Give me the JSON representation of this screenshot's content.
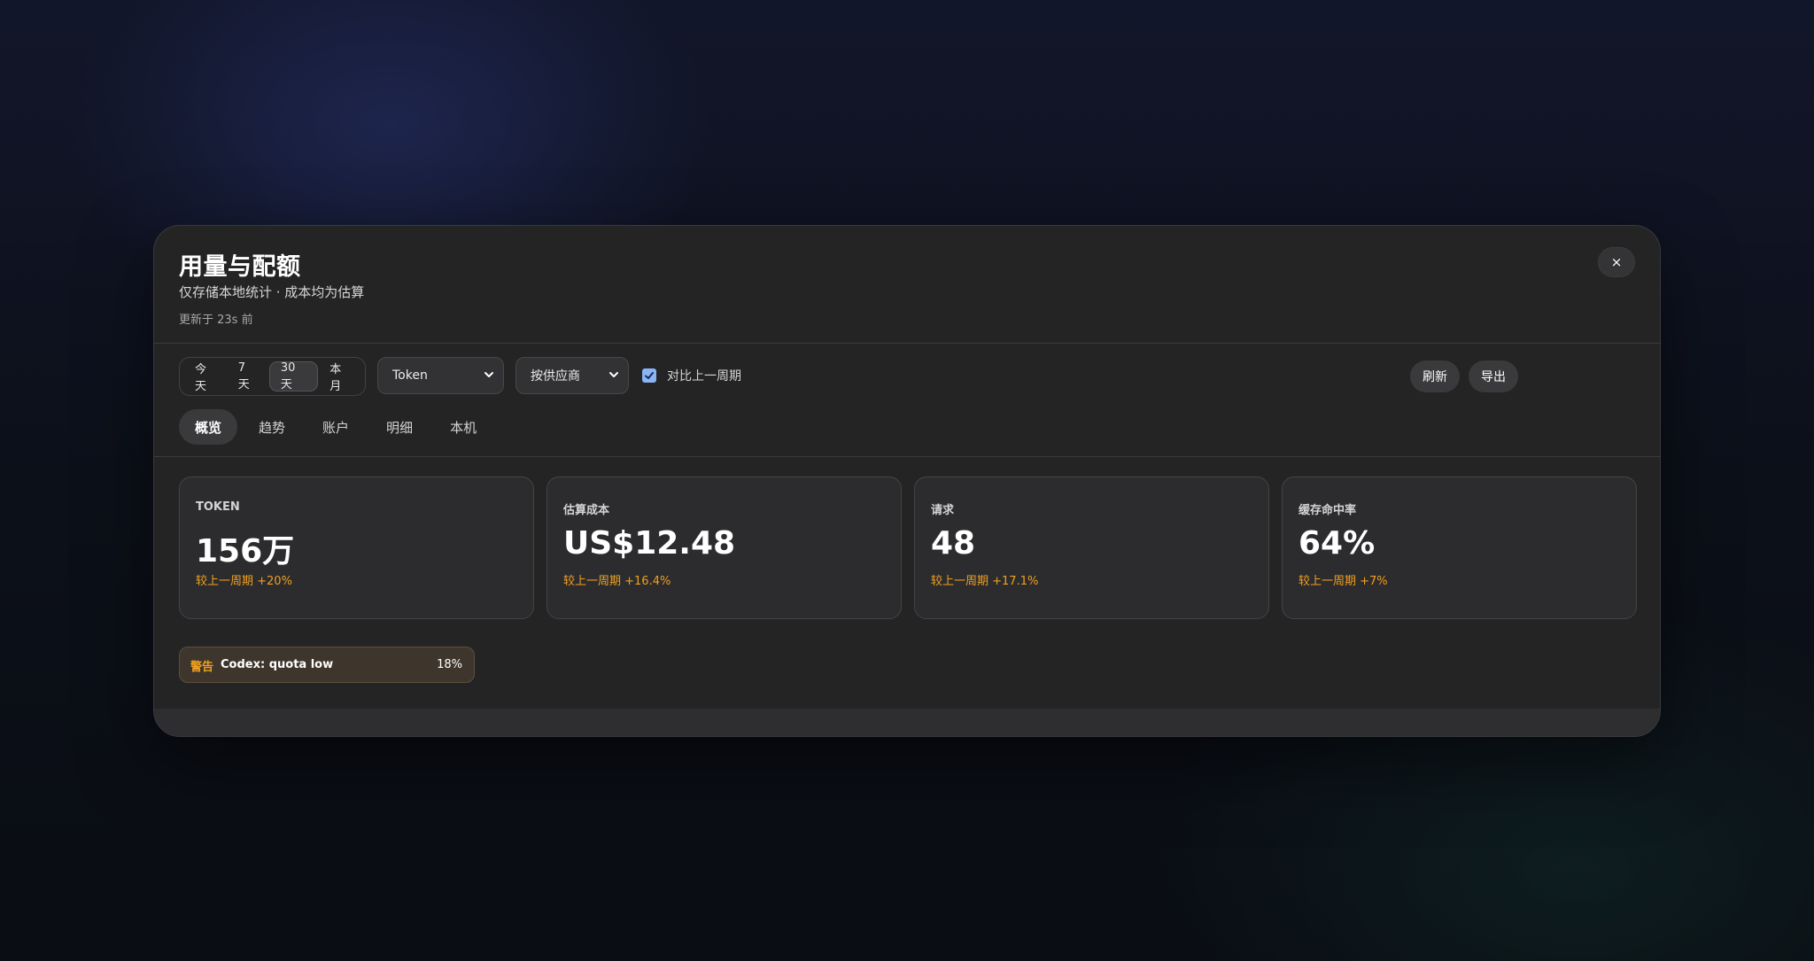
{
  "dialog": {
    "title": "用量与配额",
    "subtitle": "仅存储本地统计 · 成本均为估算",
    "updated": "更新于 23s 前",
    "close_label": "×"
  },
  "toolbar": {
    "ranges": [
      {
        "label": "今天",
        "active": false
      },
      {
        "label": "7 天",
        "active": false
      },
      {
        "label": "30 天",
        "active": true
      },
      {
        "label": "本月",
        "active": false
      }
    ],
    "metric_select": {
      "value": "Token"
    },
    "group_select": {
      "value": "按供应商"
    },
    "compare": {
      "label": "对比上一周期",
      "checked": true
    },
    "refresh_label": "刷新",
    "export_label": "导出"
  },
  "tabs": [
    {
      "label": "概览",
      "active": true
    },
    {
      "label": "趋势",
      "active": false
    },
    {
      "label": "账户",
      "active": false
    },
    {
      "label": "明细",
      "active": false
    },
    {
      "label": "本机",
      "active": false
    }
  ],
  "cards": [
    {
      "label": "TOKEN",
      "value": "156万",
      "delta": "较上一周期 +20%"
    },
    {
      "label": "估算成本",
      "value": "US$12.48",
      "delta": "较上一周期 +16.4%"
    },
    {
      "label": "请求",
      "value": "48",
      "delta": "较上一周期 +17.1%"
    },
    {
      "label": "缓存命中率",
      "value": "64%",
      "delta": "较上一周期 +7%"
    }
  ],
  "alert": {
    "tag": "警告",
    "text": "Codex: quota low",
    "percent": "18%"
  },
  "colors": {
    "accent_warning": "#f0a020",
    "checkbox": "#8ab4f8",
    "panel": "#242424"
  }
}
